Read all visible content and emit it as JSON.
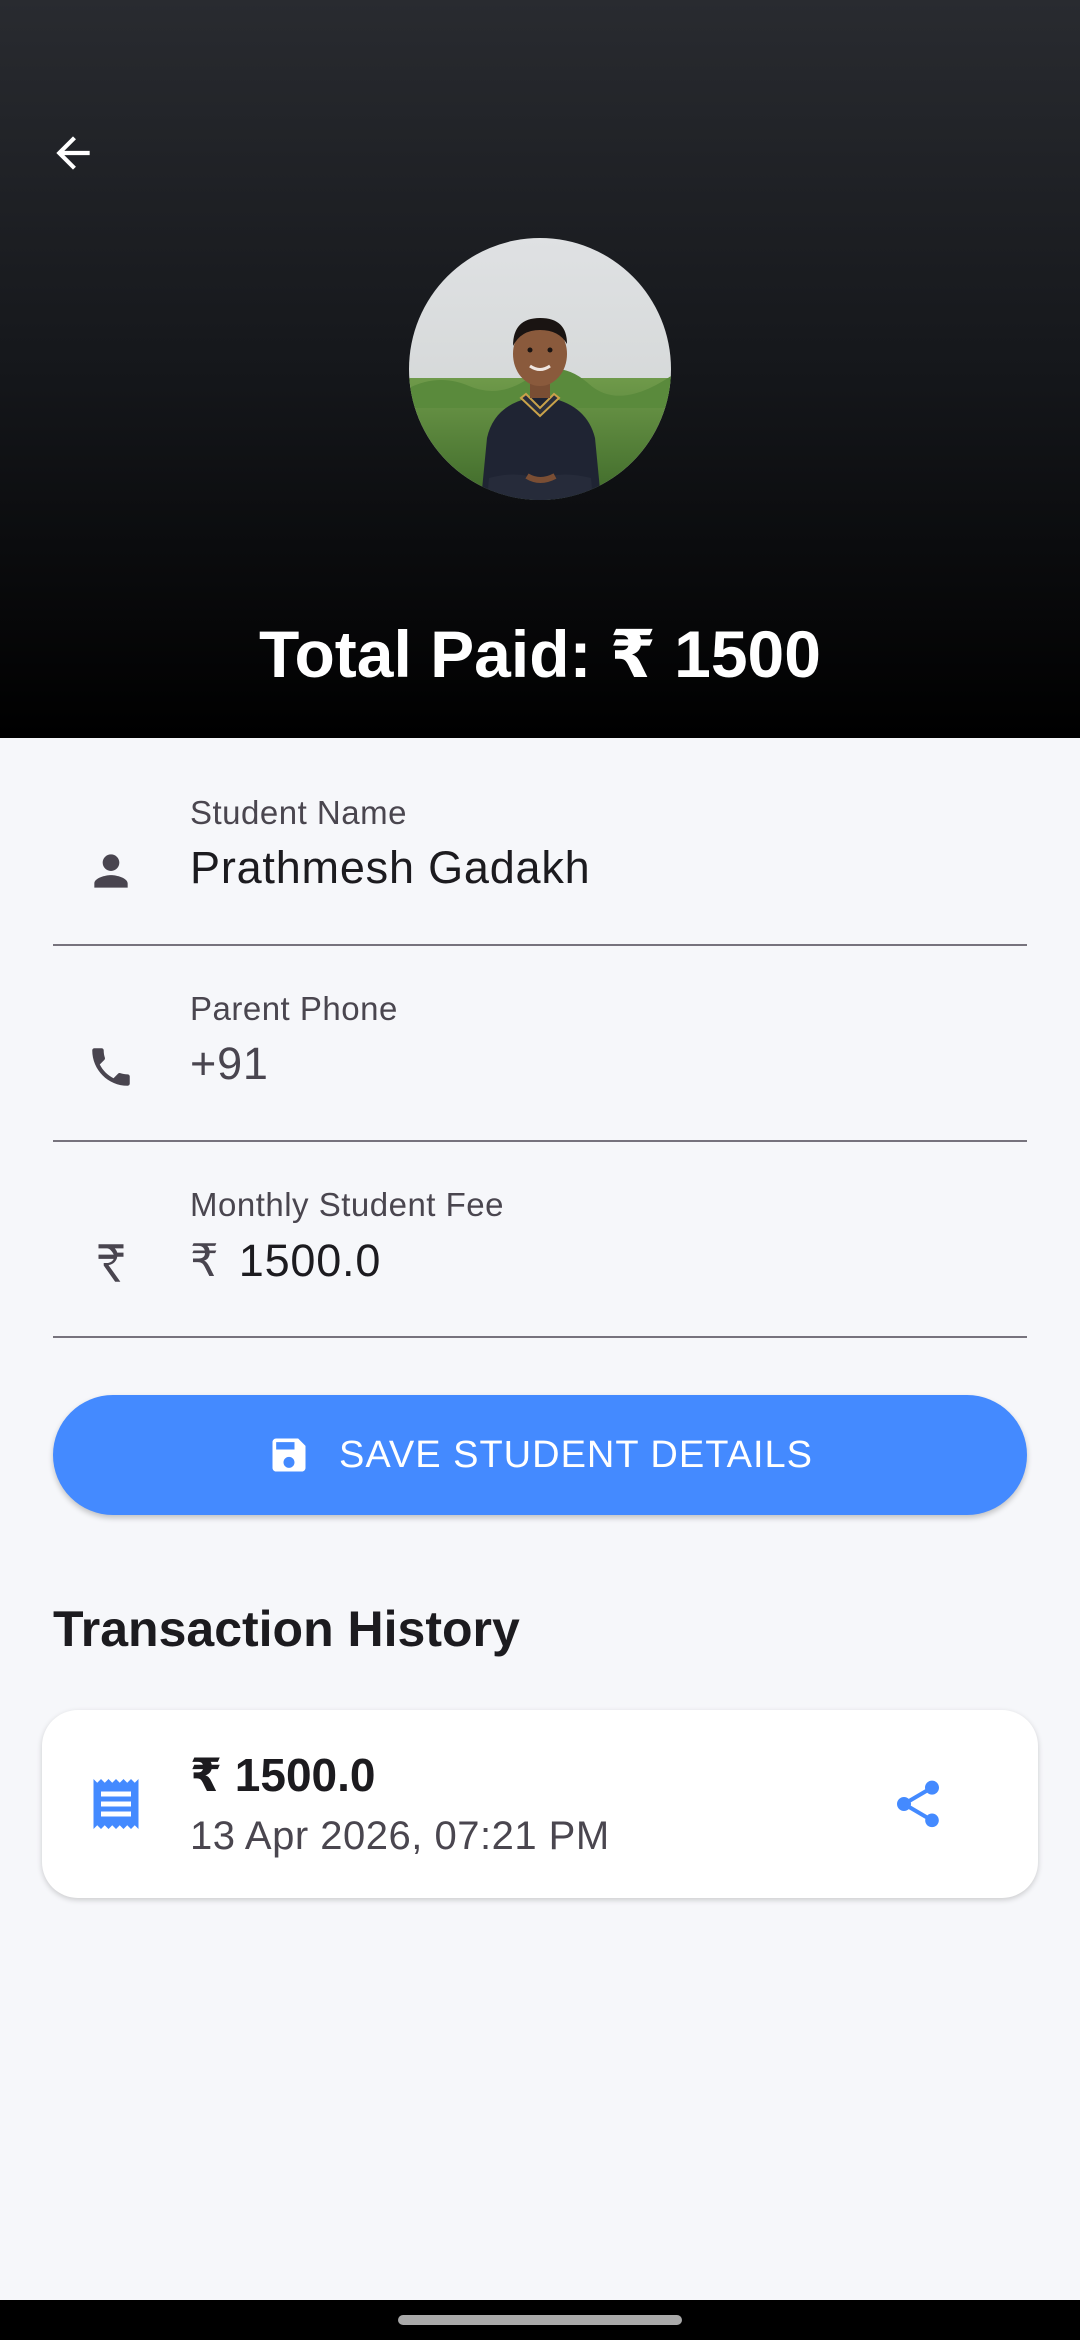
{
  "header": {
    "back_icon": "arrow-left-icon",
    "avatar_alt": "Student photo",
    "total_paid_label": "Total Paid:",
    "total_paid_currency": "₹",
    "total_paid_amount": "1500"
  },
  "form": {
    "student_name": {
      "icon": "person-icon",
      "label": "Student Name",
      "value": "Prathmesh Gadakh"
    },
    "parent_phone": {
      "icon": "phone-icon",
      "label": "Parent Phone",
      "prefix": "+91",
      "value": ""
    },
    "monthly_fee": {
      "icon": "rupee-icon",
      "label": "Monthly Student Fee",
      "prefix": "₹",
      "value": "1500.0"
    }
  },
  "save_button": {
    "icon": "save-icon",
    "label": "SAVE STUDENT DETAILS"
  },
  "transactions": {
    "title": "Transaction History",
    "items": [
      {
        "icon": "receipt-icon",
        "currency": "₹",
        "amount": "1500.0",
        "date": "13 Apr 2026, 07:21 PM",
        "share_icon": "share-icon"
      }
    ]
  },
  "colors": {
    "accent": "#448aff",
    "header_top": "#292b30",
    "header_bottom": "#000000",
    "background": "#f6f7fa"
  }
}
